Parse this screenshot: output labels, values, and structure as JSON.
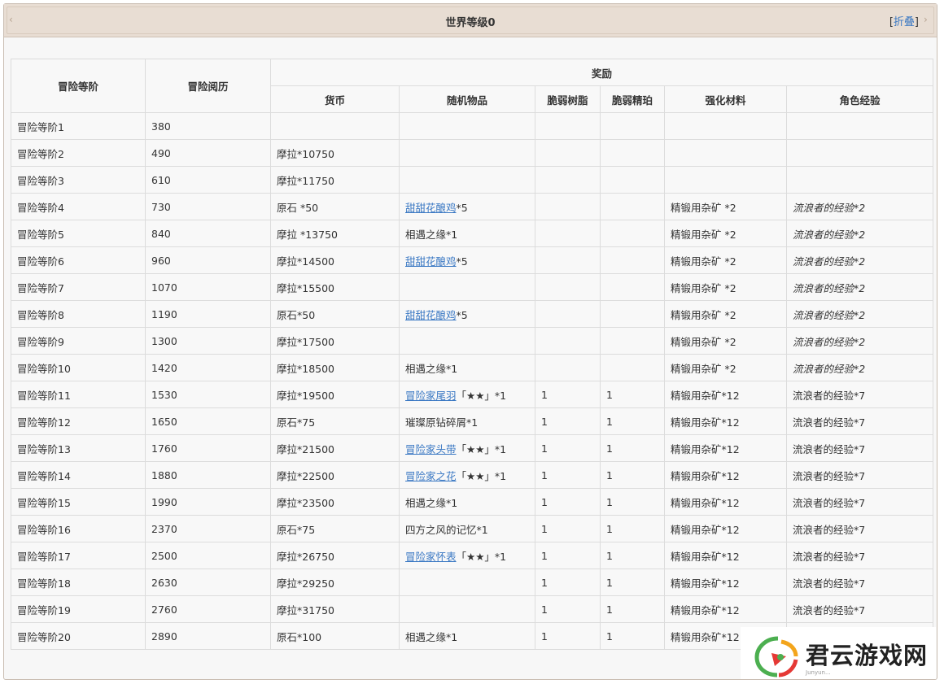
{
  "panel": {
    "title": "世界等级0",
    "toggle_open": "[",
    "toggle_label": "折叠",
    "toggle_close": "]"
  },
  "table": {
    "headers": {
      "rank": "冒险等阶",
      "exp": "冒险阅历",
      "reward": "奖励",
      "currency": "货币",
      "random_item": "随机物品",
      "fragile_resin": "脆弱树脂",
      "fragile_essence": "脆弱精珀",
      "enhance": "强化材料",
      "char_exp": "角色经验"
    },
    "rows": [
      {
        "rank": "冒险等阶1",
        "exp": "380",
        "currency": "",
        "item_link": "",
        "item_text": "",
        "resin": "",
        "essence": "",
        "enhance": "",
        "char_exp": ""
      },
      {
        "rank": "冒险等阶2",
        "exp": "490",
        "currency": "摩拉*10750",
        "item_link": "",
        "item_text": "",
        "resin": "",
        "essence": "",
        "enhance": "",
        "char_exp": ""
      },
      {
        "rank": "冒险等阶3",
        "exp": "610",
        "currency": "摩拉*11750",
        "item_link": "",
        "item_text": "",
        "resin": "",
        "essence": "",
        "enhance": "",
        "char_exp": ""
      },
      {
        "rank": "冒险等阶4",
        "exp": "730",
        "currency": "原石 *50",
        "item_link": "甜甜花酿鸡",
        "item_text": "*5",
        "resin": "",
        "essence": "",
        "enhance": "精锻用杂矿 *2",
        "char_exp": "流浪者的经验*2"
      },
      {
        "rank": "冒险等阶5",
        "exp": "840",
        "currency": "摩拉 *13750",
        "item_link": "",
        "item_text": "相遇之缘*1",
        "resin": "",
        "essence": "",
        "enhance": "精锻用杂矿 *2",
        "char_exp": "流浪者的经验*2"
      },
      {
        "rank": "冒险等阶6",
        "exp": "960",
        "currency": "摩拉*14500",
        "item_link": "甜甜花酿鸡",
        "item_text": "*5",
        "resin": "",
        "essence": "",
        "enhance": "精锻用杂矿 *2",
        "char_exp": "流浪者的经验*2"
      },
      {
        "rank": "冒险等阶7",
        "exp": "1070",
        "currency": "摩拉*15500",
        "item_link": "",
        "item_text": "",
        "resin": "",
        "essence": "",
        "enhance": "精锻用杂矿 *2",
        "char_exp": "流浪者的经验*2"
      },
      {
        "rank": "冒险等阶8",
        "exp": "1190",
        "currency": "原石*50",
        "item_link": "甜甜花酿鸡",
        "item_text": "*5",
        "resin": "",
        "essence": "",
        "enhance": "精锻用杂矿 *2",
        "char_exp": "流浪者的经验*2"
      },
      {
        "rank": "冒险等阶9",
        "exp": "1300",
        "currency": "摩拉*17500",
        "item_link": "",
        "item_text": "",
        "resin": "",
        "essence": "",
        "enhance": "精锻用杂矿 *2",
        "char_exp": "流浪者的经验*2"
      },
      {
        "rank": "冒险等阶10",
        "exp": "1420",
        "currency": "摩拉*18500",
        "item_link": "",
        "item_text": "相遇之缘*1",
        "resin": "",
        "essence": "",
        "enhance": "精锻用杂矿 *2",
        "char_exp": "流浪者的经验*2"
      },
      {
        "rank": "冒险等阶11",
        "exp": "1530",
        "currency": "摩拉*19500",
        "item_link": "冒险家尾羽",
        "item_text": "「★★」*1",
        "resin": "1",
        "essence": "1",
        "enhance": "精锻用杂矿*12",
        "char_exp": "流浪者的经验*7"
      },
      {
        "rank": "冒险等阶12",
        "exp": "1650",
        "currency": "原石*75",
        "item_link": "",
        "item_text": "璀璨原钻碎屑*1",
        "resin": "1",
        "essence": "1",
        "enhance": "精锻用杂矿*12",
        "char_exp": "流浪者的经验*7"
      },
      {
        "rank": "冒险等阶13",
        "exp": "1760",
        "currency": "摩拉*21500",
        "item_link": "冒险家头带",
        "item_text": "「★★」*1",
        "resin": "1",
        "essence": "1",
        "enhance": "精锻用杂矿*12",
        "char_exp": "流浪者的经验*7"
      },
      {
        "rank": "冒险等阶14",
        "exp": "1880",
        "currency": "摩拉*22500",
        "item_link": "冒险家之花",
        "item_text": "「★★」*1",
        "resin": "1",
        "essence": "1",
        "enhance": "精锻用杂矿*12",
        "char_exp": "流浪者的经验*7"
      },
      {
        "rank": "冒险等阶15",
        "exp": "1990",
        "currency": "摩拉*23500",
        "item_link": "",
        "item_text": "相遇之缘*1",
        "resin": "1",
        "essence": "1",
        "enhance": "精锻用杂矿*12",
        "char_exp": "流浪者的经验*7"
      },
      {
        "rank": "冒险等阶16",
        "exp": "2370",
        "currency": "原石*75",
        "item_link": "",
        "item_text": "四方之风的记忆*1",
        "resin": "1",
        "essence": "1",
        "enhance": "精锻用杂矿*12",
        "char_exp": "流浪者的经验*7"
      },
      {
        "rank": "冒险等阶17",
        "exp": "2500",
        "currency": "摩拉*26750",
        "item_link": "冒险家怀表",
        "item_text": "「★★」*1",
        "resin": "1",
        "essence": "1",
        "enhance": "精锻用杂矿*12",
        "char_exp": "流浪者的经验*7"
      },
      {
        "rank": "冒险等阶18",
        "exp": "2630",
        "currency": "摩拉*29250",
        "item_link": "",
        "item_text": "",
        "resin": "1",
        "essence": "1",
        "enhance": "精锻用杂矿*12",
        "char_exp": "流浪者的经验*7"
      },
      {
        "rank": "冒险等阶19",
        "exp": "2760",
        "currency": "摩拉*31750",
        "item_link": "",
        "item_text": "",
        "resin": "1",
        "essence": "1",
        "enhance": "精锻用杂矿*12",
        "char_exp": "流浪者的经验*7"
      },
      {
        "rank": "冒险等阶20",
        "exp": "2890",
        "currency": "原石*100",
        "item_link": "",
        "item_text": "相遇之缘*1",
        "resin": "1",
        "essence": "1",
        "enhance": "精锻用杂矿*12",
        "char_exp": ""
      }
    ]
  },
  "watermark": {
    "text": "君云游戏网",
    "sub": "Junyun..."
  }
}
